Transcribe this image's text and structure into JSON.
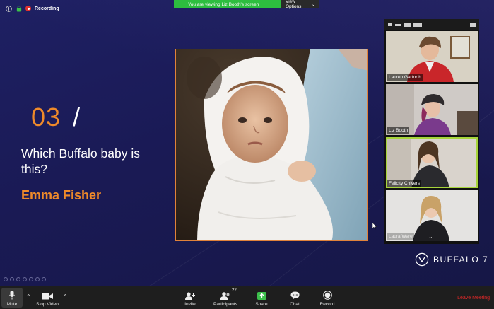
{
  "recording": {
    "label": "Recording"
  },
  "banner": {
    "viewing": "You are viewing Liz Booth's screen",
    "options": "View Options"
  },
  "slide": {
    "number": "03",
    "slash": "/",
    "question": "Which Buffalo baby is this?",
    "answer": "Emma Fisher"
  },
  "participants": [
    {
      "name": "Lauren Garforth"
    },
    {
      "name": "Liz Booth"
    },
    {
      "name": "Felicity Chivers"
    },
    {
      "name": "Laura Ware"
    }
  ],
  "brand": {
    "text": "BUFFALO 7"
  },
  "toolbar": {
    "mute": "Mute",
    "stop_video": "Stop Video",
    "invite": "Invite",
    "participants": "Participants",
    "participants_count": "22",
    "share": "Share",
    "chat": "Chat",
    "record": "Record",
    "leave": "Leave Meeting"
  },
  "colors": {
    "accent": "#ef8a2a",
    "banner": "#2dbe3f",
    "active_speaker": "#a7d53b",
    "leave": "#e02828"
  }
}
